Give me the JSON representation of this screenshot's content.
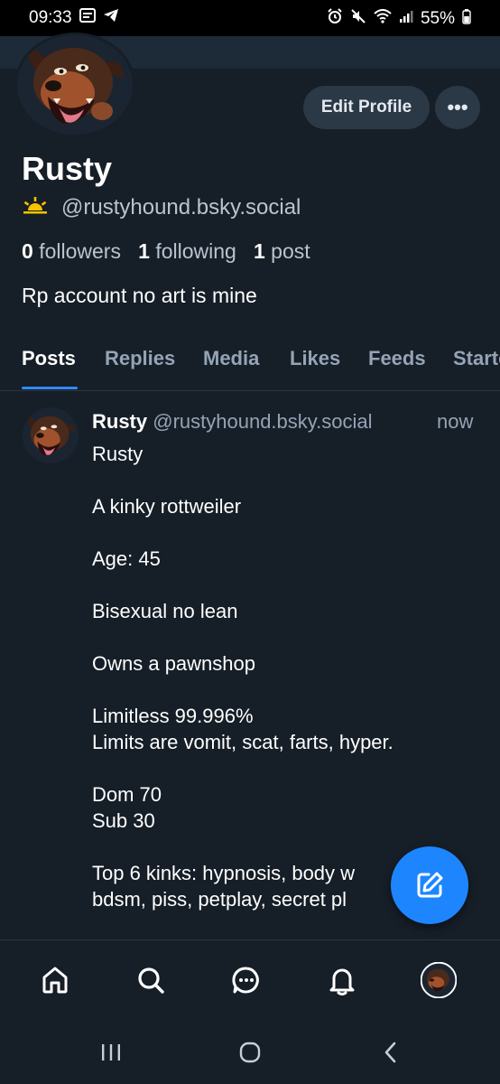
{
  "status_bar": {
    "time": "09:33",
    "battery": "55%",
    "left_icons": [
      "gallery-icon",
      "telegram-icon"
    ],
    "right_icons": [
      "alarm-icon",
      "mute-icon",
      "wifi-icon",
      "signal-icon",
      "battery-icon"
    ]
  },
  "profile": {
    "avatar_icon": "rottweiler-avatar",
    "edit_label": "Edit Profile",
    "more_label": "•••",
    "name": "Rusty",
    "handle_icon": "sunrise-icon",
    "handle": "@rustyhound.bsky.social",
    "followers_count": "0",
    "followers_label": "followers",
    "following_count": "1",
    "following_label": "following",
    "posts_count": "1",
    "posts_label": "post",
    "bio": "Rp account no art is mine"
  },
  "tabs": [
    {
      "label": "Posts",
      "active": true
    },
    {
      "label": "Replies",
      "active": false
    },
    {
      "label": "Media",
      "active": false
    },
    {
      "label": "Likes",
      "active": false
    },
    {
      "label": "Feeds",
      "active": false
    },
    {
      "label": "Starter",
      "active": false
    }
  ],
  "post": {
    "author": "Rusty",
    "handle": "@rustyhound.bsky.social",
    "time": "now",
    "text": "Rusty\n\nA kinky rottweiler\n\nAge: 45\n\nBisexual no lean\n\nOwns a pawnshop\n\nLimitless 99.996%\nLimits are vomit, scat, farts, hyper.\n\nDom 70\nSub 30\n\nTop 6 kinks: hypnosis, body w\nbdsm, piss, petplay, secret pl"
  },
  "fab_icon": "compose-icon",
  "bottom_nav": [
    "home-icon",
    "search-icon",
    "chat-icon",
    "bell-icon",
    "profile-avatar-icon"
  ],
  "system_nav": [
    "recents-icon",
    "home-circle-icon",
    "back-icon"
  ],
  "colors": {
    "background": "#161e27",
    "accent": "#1d86ff",
    "muted_text": "#94a4b6",
    "button_bg": "#2b3846"
  }
}
